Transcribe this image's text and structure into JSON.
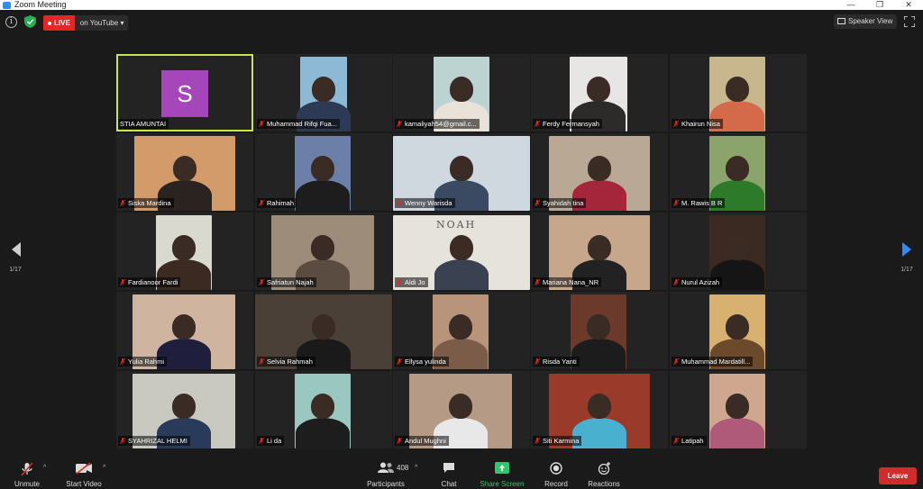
{
  "window": {
    "title": "Zoom Meeting",
    "controls": [
      "—",
      "❐",
      "✕"
    ]
  },
  "topbar": {
    "live_label": "LIVE",
    "live_target": "on YouTube",
    "speaker_view": "Speaker View",
    "accent": "#2d8cff",
    "live_color": "#e02828"
  },
  "gallery": {
    "page_left": "1/17",
    "page_right": "1/17",
    "tiles": [
      {
        "name": "STIA AMUNTAI",
        "avatar_letter": "S",
        "active": true
      },
      {
        "name": "Muhammad Rifqi Fua..."
      },
      {
        "name": "kamaliyah54@gmail.c..."
      },
      {
        "name": "Ferdy Fermansyah"
      },
      {
        "name": "Khairun Nisa"
      },
      {
        "name": "Siska Mardina"
      },
      {
        "name": "Rahimah"
      },
      {
        "name": "Wenny Warisda"
      },
      {
        "name": "Syahidah tina"
      },
      {
        "name": "M. Rawis B R"
      },
      {
        "name": "Fardianoor Fardi"
      },
      {
        "name": "Safriatun Najah"
      },
      {
        "name": "Aldi Jo"
      },
      {
        "name": "Mariana Nana_NR"
      },
      {
        "name": "Nurul Azizah"
      },
      {
        "name": "Yulia Rahmi"
      },
      {
        "name": "Selvia Rahmah"
      },
      {
        "name": "Ellysa yulinda"
      },
      {
        "name": "Risda Yanti"
      },
      {
        "name": "Muhammad Mardatill..."
      },
      {
        "name": "SYAHRIZAL HELMI"
      },
      {
        "name": "Li da"
      },
      {
        "name": "Andul Mughni"
      },
      {
        "name": "Siti Karmina"
      },
      {
        "name": "Latipah"
      }
    ],
    "cam_overlay": "NOAH"
  },
  "toolbar": {
    "unmute": "Unmute",
    "start_video": "Start Video",
    "participants": "Participants",
    "participants_count": "408",
    "chat": "Chat",
    "share_screen": "Share Screen",
    "record": "Record",
    "reactions": "Reactions",
    "leave": "Leave",
    "share_color": "#2ec76b",
    "leave_color": "#d12c2c"
  }
}
